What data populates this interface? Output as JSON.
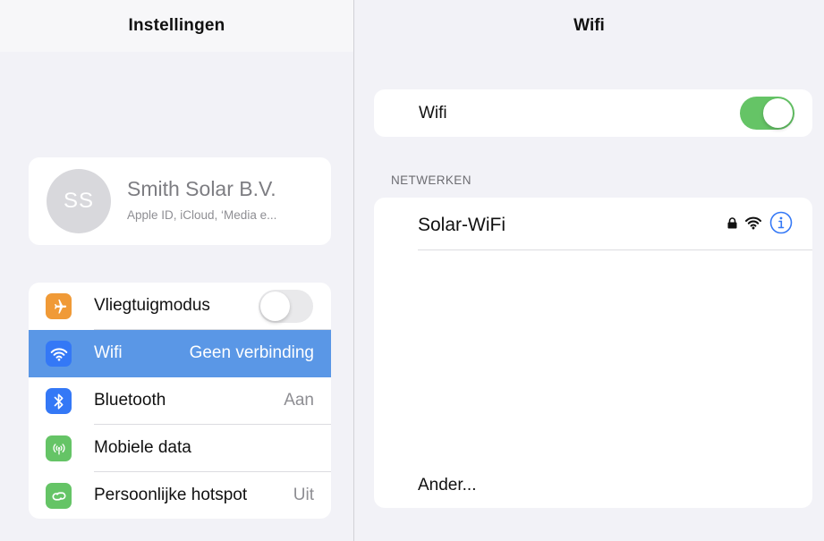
{
  "left": {
    "title": "Instellingen",
    "profile": {
      "initials": "SS",
      "name": "Smith Solar B.V.",
      "subtitle": "Apple ID, iCloud, ‘Media e..."
    },
    "items": [
      {
        "label": "Vliegtuigmodus",
        "value": "",
        "icon": "airplane-icon",
        "color": "#f09a37",
        "toggle": false
      },
      {
        "label": "Wifi",
        "value": "Geen verbinding",
        "icon": "wifi-icon",
        "color": "#3478f6",
        "selected": true
      },
      {
        "label": "Bluetooth",
        "value": "Aan",
        "icon": "bluetooth-icon",
        "color": "#3478f6"
      },
      {
        "label": "Mobiele data",
        "value": "",
        "icon": "cellular-antenna-icon",
        "color": "#65c466"
      },
      {
        "label": "Persoonlijke hotspot",
        "value": "Uit",
        "icon": "hotspot-link-icon",
        "color": "#65c466"
      }
    ]
  },
  "right": {
    "title": "Wifi",
    "wifi_toggle": {
      "label": "Wifi",
      "on": true
    },
    "section_label": "NETWERKEN",
    "networks": [
      {
        "name": "Solar-WiFi",
        "secured": true,
        "icons": [
          "lock-icon",
          "wifi-signal-icon",
          "info-icon"
        ]
      }
    ],
    "other_label": "Ander..."
  },
  "colors": {
    "accent": "#3478f6",
    "selected_row": "#5a97e6",
    "toggle_on": "#65c466",
    "toggle_off": "#e9e9eb",
    "background": "#f2f2f7"
  }
}
